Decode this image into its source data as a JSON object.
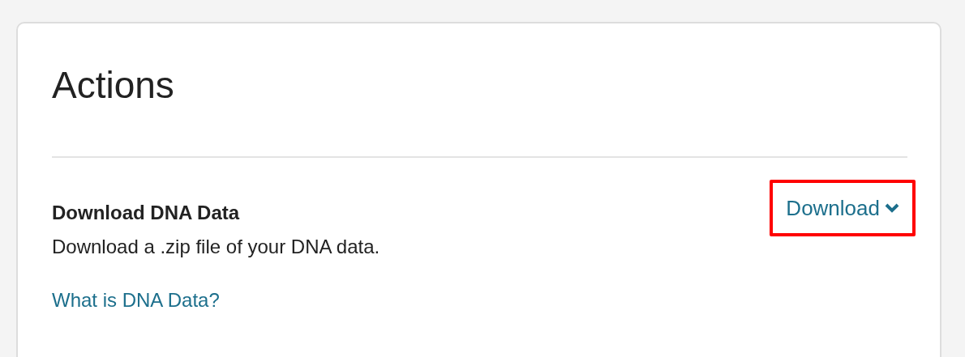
{
  "card": {
    "title": "Actions",
    "actions": [
      {
        "title": "Download DNA Data",
        "description": "Download a .zip file of your DNA data.",
        "link": "What is DNA Data?",
        "button": {
          "label": "Download",
          "highlighted": true
        }
      }
    ]
  }
}
